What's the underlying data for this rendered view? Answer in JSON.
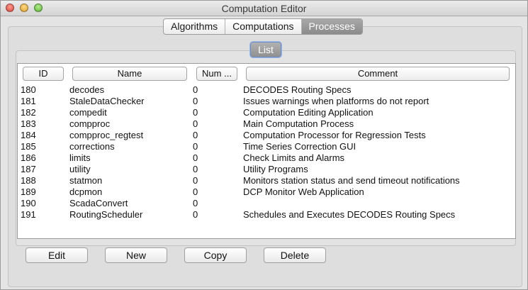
{
  "window": {
    "title": "Computation Editor"
  },
  "tabs": [
    {
      "label": "Algorithms",
      "active": false
    },
    {
      "label": "Computations",
      "active": false
    },
    {
      "label": "Processes",
      "active": true
    }
  ],
  "subtab": {
    "label": "List"
  },
  "table": {
    "columns": [
      "ID",
      "Name",
      "Num ...",
      "Comment"
    ],
    "rows": [
      {
        "id": "180",
        "name": "decodes",
        "num": "0",
        "comment": "DECODES Routing Specs"
      },
      {
        "id": "181",
        "name": "StaleDataChecker",
        "num": "0",
        "comment": "Issues warnings when platforms do not report"
      },
      {
        "id": "182",
        "name": "compedit",
        "num": "0",
        "comment": "Computation Editing Application"
      },
      {
        "id": "183",
        "name": "compproc",
        "num": "0",
        "comment": "Main Computation Process"
      },
      {
        "id": "184",
        "name": "compproc_regtest",
        "num": "0",
        "comment": "Computation Processor for Regression Tests"
      },
      {
        "id": "185",
        "name": "corrections",
        "num": "0",
        "comment": "Time Series Correction GUI"
      },
      {
        "id": "186",
        "name": "limits",
        "num": "0",
        "comment": "Check Limits and Alarms"
      },
      {
        "id": "187",
        "name": "utility",
        "num": "0",
        "comment": "Utility Programs"
      },
      {
        "id": "188",
        "name": "statmon",
        "num": "0",
        "comment": "Monitors station status and send timeout notifications"
      },
      {
        "id": "189",
        "name": "dcpmon",
        "num": "0",
        "comment": "DCP Monitor Web Application"
      },
      {
        "id": "190",
        "name": "ScadaConvert",
        "num": "0",
        "comment": ""
      },
      {
        "id": "191",
        "name": "RoutingScheduler",
        "num": "0",
        "comment": "Schedules and Executes DECODES Routing Specs"
      }
    ]
  },
  "buttons": {
    "edit": "Edit",
    "new": "New",
    "copy": "Copy",
    "delete": "Delete"
  }
}
